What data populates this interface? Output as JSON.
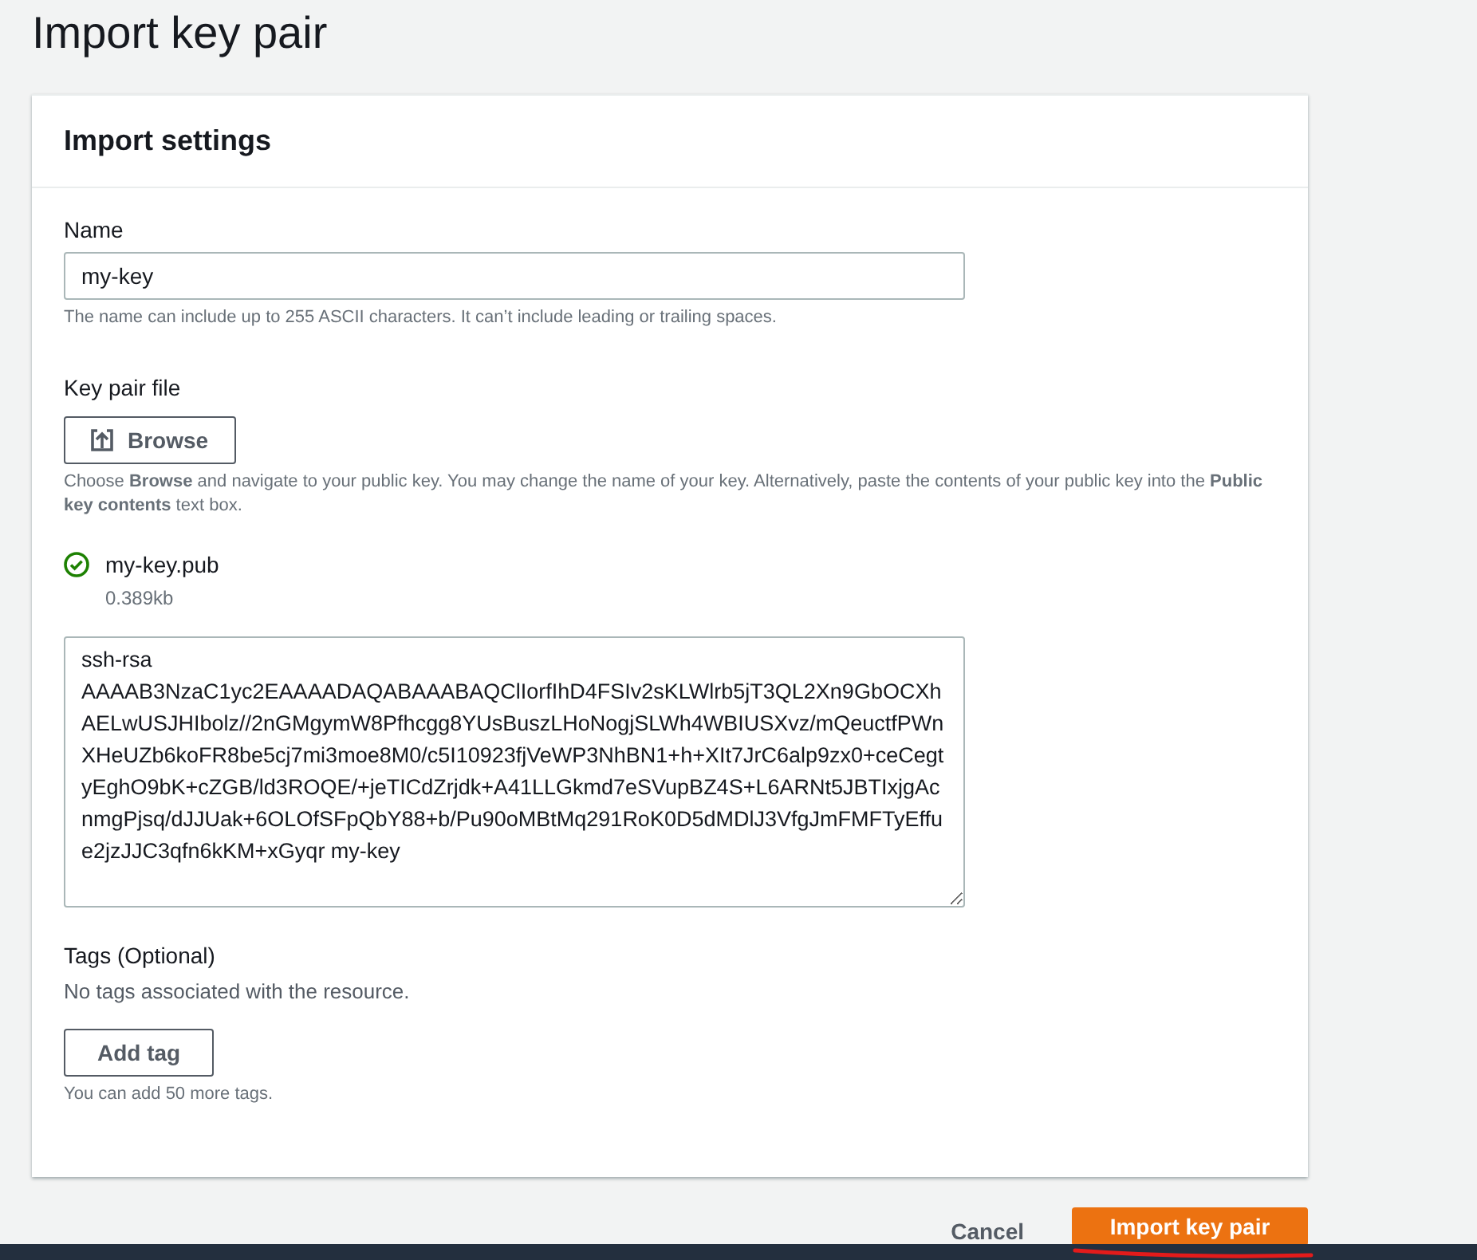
{
  "page_title": "Import key pair",
  "panel": {
    "title": "Import settings",
    "name_field": {
      "label": "Name",
      "value": "my-key",
      "hint": "The name can include up to 255 ASCII characters. It can’t include leading or trailing spaces."
    },
    "key_file": {
      "label": "Key pair file",
      "browse_button": "Browse",
      "hint": "Choose **Browse** and navigate to your public key. You may change the name of your key. Alternatively, paste the contents of your public key into the **Public key contents** text box.",
      "file": {
        "name": "my-key.pub",
        "size": "0.389kb",
        "verified": true
      }
    },
    "public_key_contents": {
      "value": "ssh-rsa\nAAAAB3NzaC1yc2EAAAADAQABAAABAQClIorfIhD4FSIv2sKLWlrb5jT3QL2Xn9GbOCXhAELwUSJHIbolz//2nGMgymW8Pfhcgg8YUsBuszLHoNogjSLWh4WBIUSXvz/mQeuctfPWnXHeUZb6koFR8be5cj7mi3moe8M0/c5I10923fjVeWP3NhBN1+h+XIt7JrC6alp9zx0+ceCegtyEghO9bK+cZGB/ld3ROQE/+jeTICdZrjdk+A41LLGkmd7eSVupBZ4S+L6ARNt5JBTIxjgAcnmgPjsq/dJJUak+6OLOfSFpQbY88+b/Pu90oMBtMq291RoK0D5dMDlJ3VfgJmFMFTyEffue2jzJJC3qfn6kKM+xGyqr my-key"
    },
    "tags": {
      "label": "Tags (Optional)",
      "empty_text": "No tags associated with the resource.",
      "add_button": "Add tag",
      "hint": "You can add 50 more tags."
    }
  },
  "footer": {
    "cancel": "Cancel",
    "submit": "Import key pair"
  }
}
